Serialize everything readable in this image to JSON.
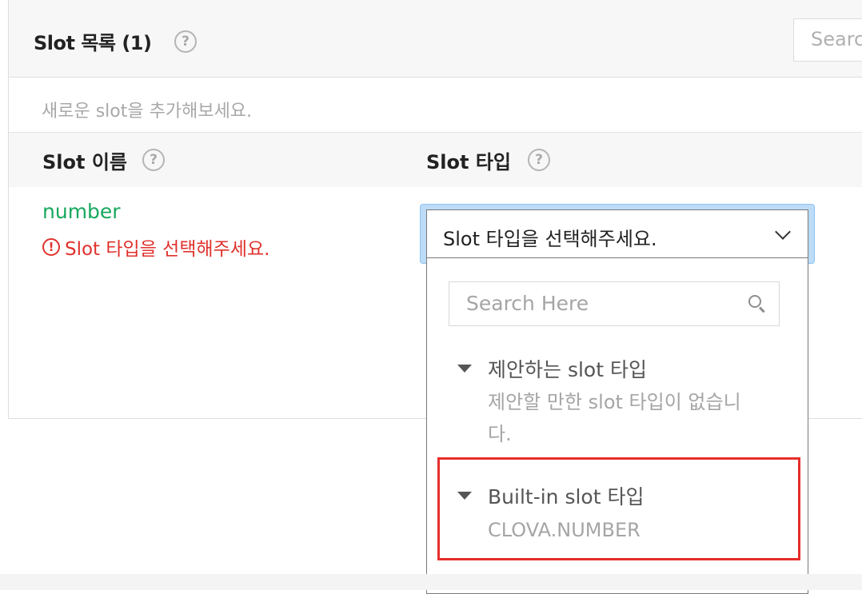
{
  "header": {
    "title": "Slot 목록 (1)",
    "help_glyph": "?",
    "search_placeholder": "Search"
  },
  "hint_text": "새로운 slot을 추가해보세요.",
  "columns": {
    "name_label": "Slot 이름",
    "type_label": "Slot 타입",
    "help_glyph": "?"
  },
  "row": {
    "slot_name": "number",
    "error_glyph": "!",
    "error_text": "Slot 타입을 선택해주세요."
  },
  "select": {
    "placeholder": "Slot 타입을 선택해주세요."
  },
  "dropdown": {
    "search_placeholder": "Search Here",
    "groups": [
      {
        "label": "제안하는 slot 타입",
        "items": [
          "제안할 만한 slot 타입이 없습니",
          "다."
        ]
      },
      {
        "label": "Built-in slot 타입",
        "items": [
          "CLOVA.NUMBER"
        ]
      }
    ]
  },
  "colors": {
    "accent_green": "#17a85d",
    "error_red": "#e0322d",
    "highlight_red": "#e62e2a",
    "focus_blue": "#bcdcf8"
  }
}
